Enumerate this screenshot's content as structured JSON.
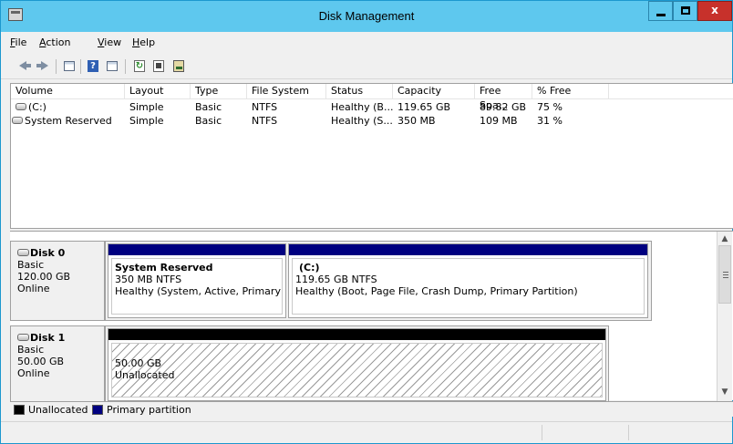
{
  "window": {
    "title": "Disk Management"
  },
  "menu": [
    {
      "label": "File",
      "accel": "F",
      "rest": "ile"
    },
    {
      "label": "Action",
      "accel": "A",
      "rest": "ction"
    },
    {
      "label": "View",
      "accel": "V",
      "rest": "iew"
    },
    {
      "label": "Help",
      "accel": "H",
      "rest": "elp"
    }
  ],
  "toolbar": {
    "icons": [
      "back-arrow-icon",
      "forward-arrow-icon",
      "grid-view-icon",
      "help-icon",
      "list-view-icon",
      "refresh-icon",
      "properties-icon",
      "disk-properties-icon"
    ]
  },
  "volume_list": {
    "columns": [
      "Volume",
      "Layout",
      "Type",
      "File System",
      "Status",
      "Capacity",
      "Free Spa...",
      "% Free"
    ],
    "rows": [
      [
        "(C:)",
        "Simple",
        "Basic",
        "NTFS",
        "Healthy (B...",
        "119.65 GB",
        "89.82 GB",
        "75 %"
      ],
      [
        "System Reserved",
        "Simple",
        "Basic",
        "NTFS",
        "Healthy (S...",
        "350 MB",
        "109 MB",
        "31 %"
      ]
    ]
  },
  "disks": [
    {
      "name": "Disk 0",
      "type": "Basic",
      "size": "120.00 GB",
      "state": "Online",
      "partitions": [
        {
          "name": "System Reserved",
          "size": "350 MB NTFS",
          "status": "Healthy (System, Active, Primary Part"
        },
        {
          "name": "(C:)",
          "size": "119.65 GB NTFS",
          "status": "Healthy (Boot, Page File, Crash Dump, Primary Partition)"
        }
      ]
    },
    {
      "name": "Disk 1",
      "type": "Basic",
      "size": "50.00 GB",
      "state": "Online",
      "partitions": [
        {
          "size": "50.00 GB",
          "status": "Unallocated"
        }
      ]
    }
  ],
  "legend": [
    {
      "label": "Unallocated",
      "color": "#000000"
    },
    {
      "label": "Primary partition",
      "color": "#000080"
    }
  ],
  "colors": {
    "title_bar": "#5ec8ee",
    "close_button": "#c7312b",
    "primary_partition": "#000080",
    "unallocated": "#000000"
  }
}
